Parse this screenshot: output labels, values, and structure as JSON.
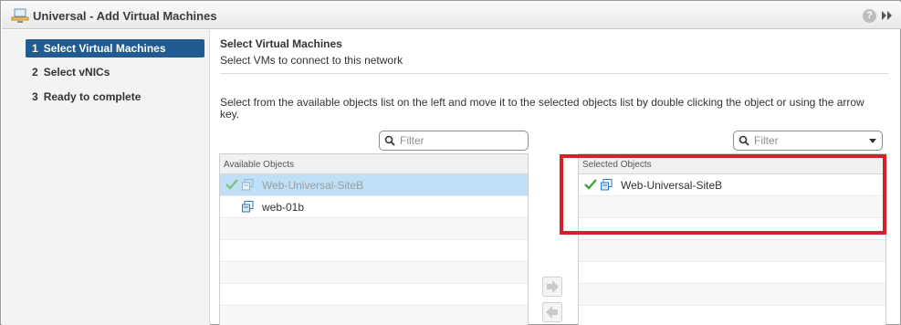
{
  "title": "Universal - Add Virtual Machines",
  "help_label": "?",
  "steps": [
    {
      "num": "1",
      "label": "Select Virtual Machines",
      "active": true
    },
    {
      "num": "2",
      "label": "Select vNICs",
      "active": false
    },
    {
      "num": "3",
      "label": "Ready to complete",
      "active": false
    }
  ],
  "section": {
    "title": "Select Virtual Machines",
    "subtitle": "Select VMs to connect to this network",
    "instructions": "Select from the available objects list on the left and move it to the selected objects list by double clicking the object or using the arrow key."
  },
  "available": {
    "filter_placeholder": "Filter",
    "header": "Available Objects",
    "items": [
      {
        "label": "Web-Universal-SiteB",
        "checked": true,
        "selected": true,
        "dim": true
      },
      {
        "label": "web-01b",
        "checked": false,
        "selected": false,
        "dim": false
      }
    ]
  },
  "selected": {
    "filter_placeholder": "Filter",
    "header": "Selected Objects",
    "items": [
      {
        "label": "Web-Universal-SiteB",
        "checked": true
      }
    ]
  },
  "colors": {
    "active_step": "#215b8f",
    "selected_row": "#bfe0f7",
    "highlight": "#d6202c",
    "check": "#3ea83e"
  }
}
